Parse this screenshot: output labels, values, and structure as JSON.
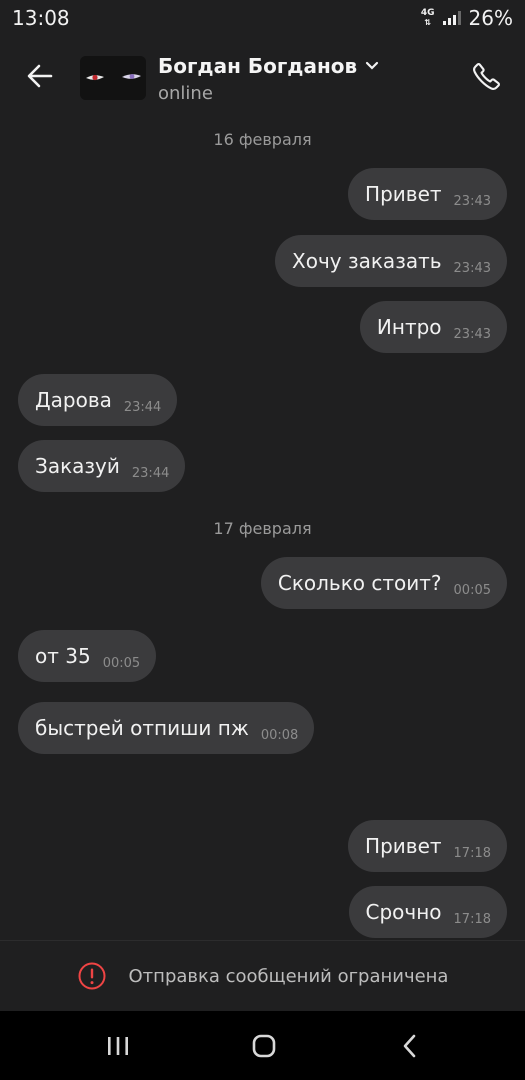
{
  "status_bar": {
    "time": "13:08",
    "network": "4G",
    "battery": "26%"
  },
  "header": {
    "contact_name": "Богдан Богданов",
    "contact_status": "online"
  },
  "messages": [
    {
      "date": "16 февраля"
    },
    {
      "dir": "out",
      "text": "Привет",
      "time": "23:43"
    },
    {
      "dir": "out",
      "text": "Хочу заказать",
      "time": "23:43"
    },
    {
      "dir": "out",
      "text": "Интро",
      "time": "23:43"
    },
    {
      "dir": "in",
      "text": "Дарова",
      "time": "23:44"
    },
    {
      "dir": "in",
      "text": "Заказуй",
      "time": "23:44"
    },
    {
      "date": "17 февраля"
    },
    {
      "dir": "out",
      "text": "Сколько стоит?",
      "time": "00:05"
    },
    {
      "dir": "in",
      "text": "от 35",
      "time": "00:05"
    },
    {
      "dir": "in",
      "text": "быстрей отпиши пж",
      "time": "00:08"
    },
    {
      "dir": "out",
      "text": "Привет",
      "time": "17:18"
    },
    {
      "dir": "out",
      "text": "Срочно",
      "time": "17:18"
    }
  ],
  "composer": {
    "restricted_text": "Отправка сообщений ограничена",
    "icon": "alert-circle-icon"
  },
  "colors": {
    "background": "#1f1f20",
    "bubble": "#3b3b3d",
    "alert": "#ef4444"
  },
  "nav_bar": {
    "icons": [
      "recents-icon",
      "home-icon",
      "back-nav-icon"
    ]
  }
}
